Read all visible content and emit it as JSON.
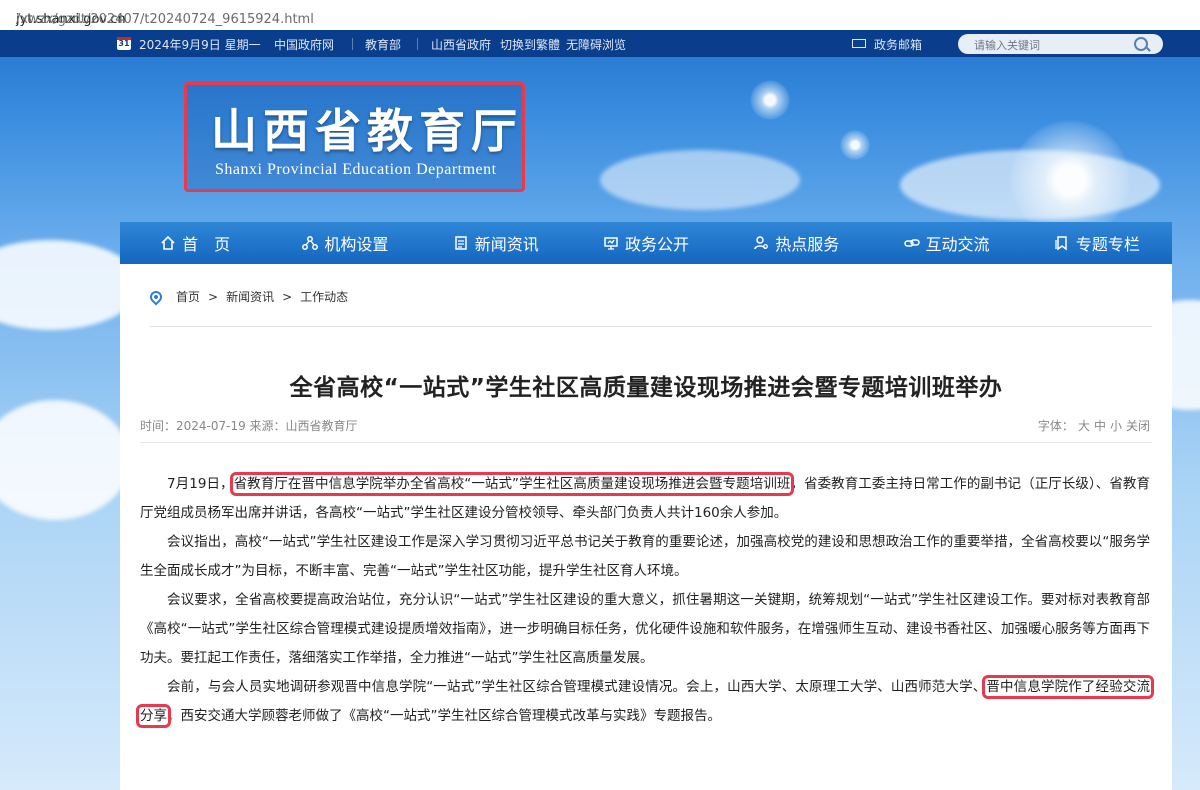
{
  "address_bar": {
    "host": "jyt.shanxi.gov.cn",
    "path": "/xwzx/gzdt/202407/t20240724_9615924.html"
  },
  "topbar": {
    "calendar_day": "31",
    "date": "2024年9月9日 星期一",
    "links": [
      "中国政府网",
      "教育部",
      "山西省政府",
      "切换到繁體",
      "无障碍浏览"
    ],
    "mail": "政务邮箱",
    "search_placeholder": "请输入关键词"
  },
  "logo": {
    "cn": "山西省教育厅",
    "en": "Shanxi Provincial Education Department"
  },
  "nav": [
    {
      "label": "首　页",
      "icon": "home-icon"
    },
    {
      "label": "机构设置",
      "icon": "org-icon"
    },
    {
      "label": "新闻资讯",
      "icon": "document-icon"
    },
    {
      "label": "政务公开",
      "icon": "screen-icon"
    },
    {
      "label": "热点服务",
      "icon": "user-icon"
    },
    {
      "label": "互动交流",
      "icon": "link-icon"
    },
    {
      "label": "专题专栏",
      "icon": "bookmark-icon"
    }
  ],
  "breadcrumb": [
    "首页",
    "新闻资讯",
    "工作动态"
  ],
  "breadcrumb_sep": ">",
  "article": {
    "title": "全省高校“一站式”学生社区高质量建设现场推进会暨专题培训班举办",
    "meta": "时间：2024-07-19  来源：山西省教育厅",
    "font_label": "字体：",
    "font_options": [
      "大",
      "中",
      "小",
      "关闭"
    ],
    "p1_a": "7月19日，",
    "p1_hl": "省教育厅在晋中信息学院举办全省高校“一站式”学生社区高质量建设现场推进会暨专题培训班",
    "p1_b": "，省委教育工委主持日常工作的副书记（正厅长级）、省教育厅党组成员杨军出席并讲话，各高校“一站式”学生社区建设分管校领导、牵头部门负责人共计160余人参加。",
    "p2": "会议指出，高校“一站式”学生社区建设工作是深入学习贯彻习近平总书记关于教育的重要论述，加强高校党的建设和思想政治工作的重要举措，全省高校要以“服务学生全面成长成才”为目标，不断丰富、完善“一站式”学生社区功能，提升学生社区育人环境。",
    "p3": "会议要求，全省高校要提高政治站位，充分认识“一站式”学生社区建设的重大意义，抓住暑期这一关键期，统筹规划“一站式”学生社区建设工作。要对标对表教育部《高校“一站式”学生社区综合管理模式建设提质增效指南》，进一步明确目标任务，优化硬件设施和软件服务，在增强师生互动、建设书香社区、加强暖心服务等方面再下功夫。要扛起工作责任，落细落实工作举措，全力推进“一站式”学生社区高质量发展。",
    "p4_a": "会前，与会人员实地调研参观晋中信息学院“一站式”学生社区综合管理模式建设情况。会上，山西大学、太原理工大学、山西师范大学、",
    "p4_hl": "晋中信息学院作了经验交流分享",
    "p4_b": "，西安交通大学顾蓉老师做了《高校“一站式”学生社区综合管理模式改革与实践》专题报告。"
  },
  "colors": {
    "nav": "#1c72c8",
    "topbar": "#0a3e8c",
    "highlight": "#e8394d"
  }
}
